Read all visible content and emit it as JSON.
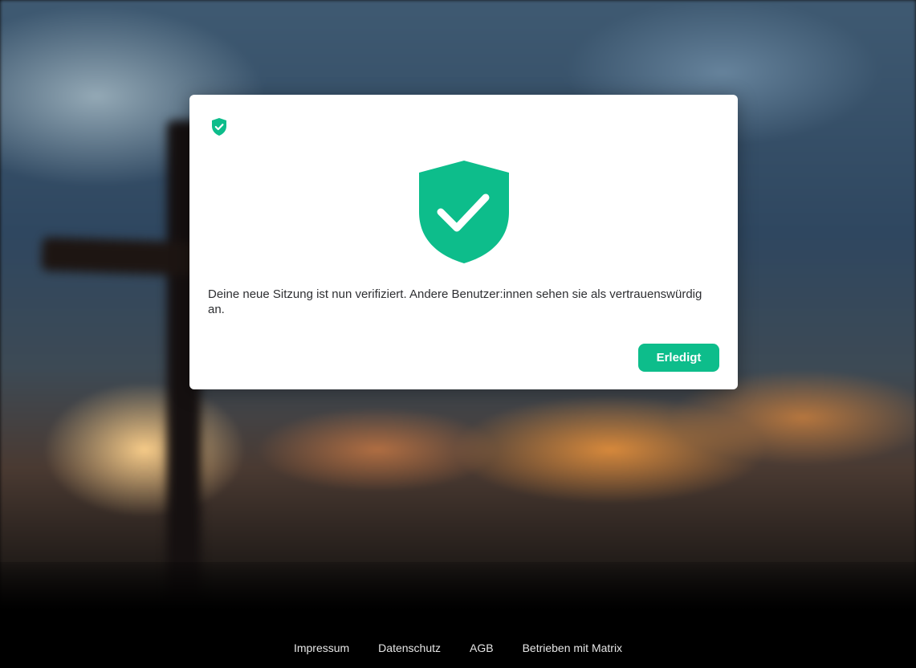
{
  "dialog": {
    "small_icon": "shield-check-icon",
    "large_icon": "shield-check-icon",
    "message": "Deine neue Sitzung ist nun verifiziert. Andere Benutzer:innen sehen sie als vertrauenswürdig an.",
    "done_label": "Erledigt",
    "accent_color": "#0dbd8b"
  },
  "footer": {
    "links": [
      {
        "label": "Impressum"
      },
      {
        "label": "Datenschutz"
      },
      {
        "label": "AGB"
      },
      {
        "label": "Betrieben mit Matrix"
      }
    ]
  }
}
